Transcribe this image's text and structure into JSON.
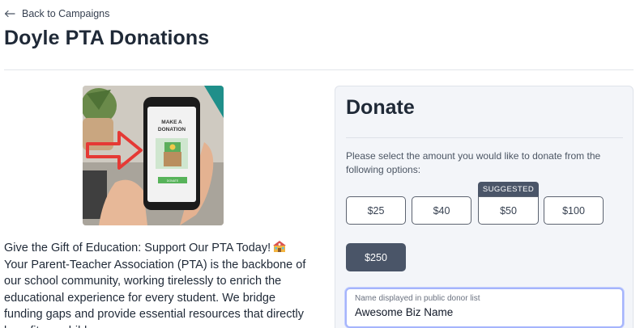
{
  "nav": {
    "back_label": "Back to Campaigns"
  },
  "page": {
    "title": "Doyle PTA Donations"
  },
  "hero_image": {
    "screen_text_line1": "MAKE A",
    "screen_text_line2": "DONATION",
    "button_text": "DONATE"
  },
  "description": {
    "headline": "Give the Gift of Education: Support Our PTA Today!",
    "headline_icon": "school-emoji-icon",
    "body": "Your Parent-Teacher Association (PTA) is the backbone of our school community, working tirelessly to enrich the educational experience for every student. We bridge funding gaps and provide essential resources that directly benefit our children."
  },
  "donate": {
    "title": "Donate",
    "instructions": "Please select the amount you would like to donate from the following options:",
    "suggested_badge": "SUGGESTED",
    "amounts": [
      "$25",
      "$40",
      "$50",
      "$100",
      "$250"
    ],
    "suggested_amount": "$50",
    "selected_amount": "$250",
    "name_field": {
      "label": "Name displayed in public donor list",
      "value": "Awesome Biz Name"
    }
  },
  "colors": {
    "selected_button": "#4a5568",
    "focus_ring": "#a5b4fc",
    "panel_bg": "#f3f5f9"
  }
}
